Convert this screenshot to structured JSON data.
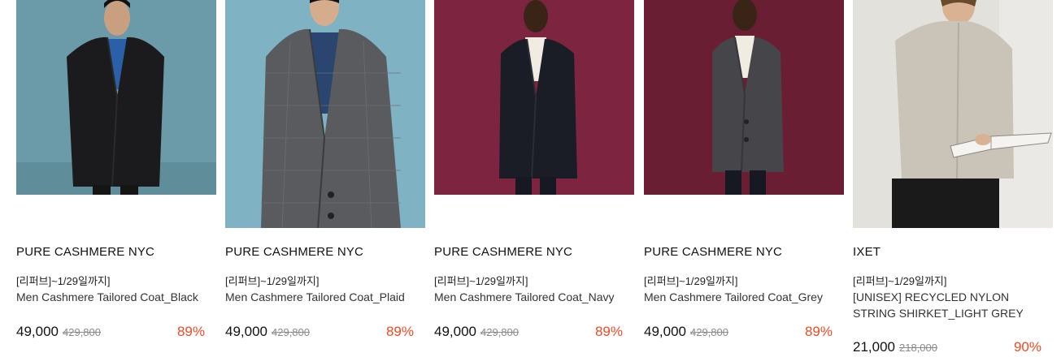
{
  "products": [
    {
      "brand": "PURE CASHMERE NYC",
      "tag": "[리퍼브]~1/29일까지]",
      "title": "Men Cashmere Tailored Coat_Black",
      "price": "49,000",
      "original_price": "429,800",
      "discount": "89%",
      "image_alt": "model-black-coat-image",
      "bg_color": "#6b9aa8",
      "coat_color": "#1b1b1d"
    },
    {
      "brand": "PURE CASHMERE NYC",
      "tag": "[리퍼브]~1/29일까지]",
      "title": "Men Cashmere Tailored Coat_Plaid",
      "price": "49,000",
      "original_price": "429,800",
      "discount": "89%",
      "image_alt": "model-plaid-coat-image",
      "bg_color": "#7fb3c4",
      "coat_color": "#5a5b5e"
    },
    {
      "brand": "PURE CASHMERE NYC",
      "tag": "[리퍼브]~1/29일까지]",
      "title": "Men Cashmere Tailored Coat_Navy",
      "price": "49,000",
      "original_price": "429,800",
      "discount": "89%",
      "image_alt": "model-navy-coat-image",
      "bg_color": "#7d2440",
      "coat_color": "#1a1c26"
    },
    {
      "brand": "PURE CASHMERE NYC",
      "tag": "[리퍼브]~1/29일까지]",
      "title": "Men Cashmere Tailored Coat_Grey",
      "price": "49,000",
      "original_price": "429,800",
      "discount": "89%",
      "image_alt": "model-grey-coat-image",
      "bg_color": "#6a1e33",
      "coat_color": "#46464a"
    },
    {
      "brand": "IXET",
      "tag": "[리퍼브]~1/29일까지]",
      "title": "[UNISEX] RECYCLED NYLON STRING SHIRKET_LIGHT GREY",
      "price": "21,000",
      "original_price": "218,000",
      "discount": "90%",
      "image_alt": "model-light-grey-shirket-image",
      "bg_color": "#e3e1dc",
      "coat_color": "#c9c4b7"
    }
  ],
  "colors": {
    "discount": "#ee4a22",
    "strike": "#8a8a8a"
  }
}
